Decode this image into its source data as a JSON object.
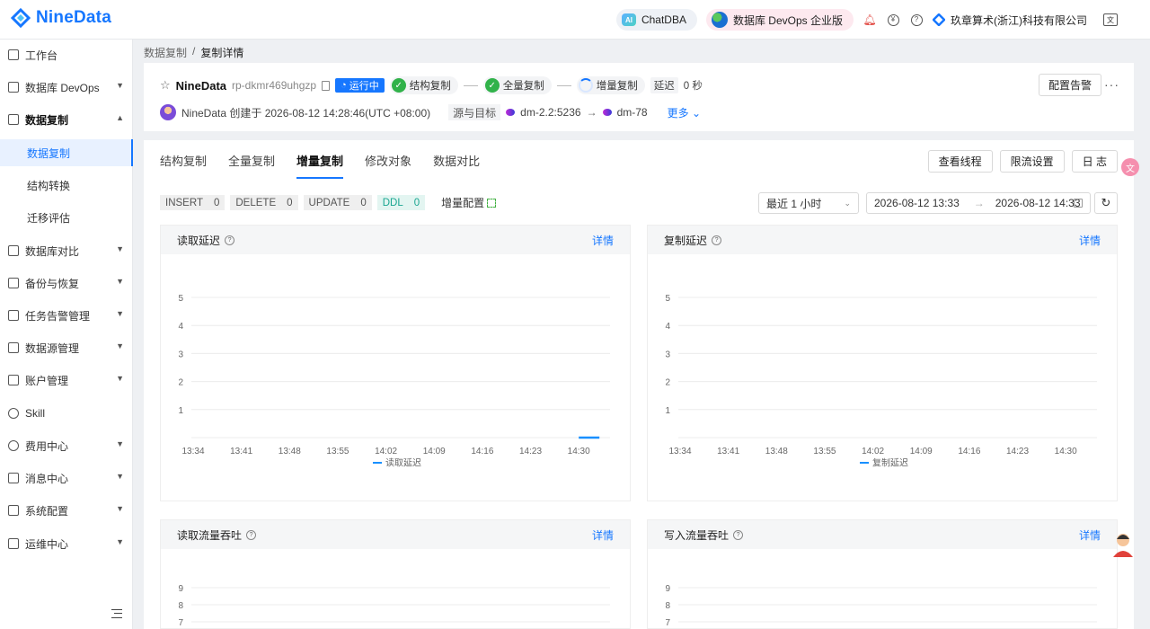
{
  "app": {
    "logo_text": "NineData",
    "chatdba_label": "ChatDBA",
    "ai_badge": "AI",
    "devops_label": "数据库 DevOps 企业版",
    "company": "玖章算术(浙江)科技有限公司",
    "lang_icon": "文",
    "accent": "#1677ff"
  },
  "sidebar": {
    "items": [
      {
        "label": "工作台",
        "icon": "home-icon"
      },
      {
        "label": "数据库 DevOps",
        "icon": "monitor-icon"
      },
      {
        "label": "数据复制",
        "icon": "replicate-icon"
      },
      {
        "label": "数据库对比",
        "icon": "compare-icon"
      },
      {
        "label": "备份与恢复",
        "icon": "cloud-icon"
      },
      {
        "label": "任务告警管理",
        "icon": "alarm-icon"
      },
      {
        "label": "数据源管理",
        "icon": "datasource-icon"
      },
      {
        "label": "账户管理",
        "icon": "account-icon"
      },
      {
        "label": "Skill",
        "icon": "skill-icon"
      },
      {
        "label": "费用中心",
        "icon": "yen-icon"
      },
      {
        "label": "消息中心",
        "icon": "mail-icon"
      },
      {
        "label": "系统配置",
        "icon": "grid-icon"
      },
      {
        "label": "运维中心",
        "icon": "wrench-icon"
      }
    ],
    "sub_items": [
      "数据复制",
      "结构转换",
      "迁移评估"
    ]
  },
  "breadcrumb": {
    "root": "数据复制",
    "sep": "/",
    "current": "复制详情"
  },
  "task": {
    "name": "NineData",
    "id": "rp-dkmr469uhgzp",
    "status": "运行中",
    "stages": [
      "结构复制",
      "全量复制",
      "增量复制"
    ],
    "delay_label": "延迟",
    "delay_value": "0 秒",
    "alarm_button": "配置告警",
    "more_dots": "···",
    "creator_text": "NineData 创建于 2026-08-12 14:28:46(UTC +08:00)",
    "src_tgt_label": "源与目标",
    "source": "dm-2.2:5236",
    "arrow": "→",
    "target": "dm-78",
    "more": "更多"
  },
  "tabs": [
    "结构复制",
    "全量复制",
    "增量复制",
    "修改对象",
    "数据对比"
  ],
  "tab_buttons": [
    "查看线程",
    "限流设置",
    "日 志"
  ],
  "counters": [
    {
      "key": "INSERT",
      "value": "0"
    },
    {
      "key": "DELETE",
      "value": "0"
    },
    {
      "key": "UPDATE",
      "value": "0"
    },
    {
      "key": "DDL",
      "value": "0"
    }
  ],
  "inc_config": "增量配置",
  "filter": {
    "range_select": "最近 1 小时",
    "start": "2026-08-12 13:33",
    "arrow": "→",
    "end": "2026-08-12 14:33",
    "refresh_icon": "↻"
  },
  "charts": [
    {
      "title": "读取延迟",
      "link": "详情",
      "legend": "读取延迟"
    },
    {
      "title": "复制延迟",
      "link": "详情",
      "legend": "复制延迟"
    },
    {
      "title": "读取流量吞吐",
      "link": "详情"
    },
    {
      "title": "写入流量吞吐",
      "link": "详情"
    }
  ],
  "chart_data": [
    {
      "type": "line",
      "title": "读取延迟",
      "categories": [
        "13:34",
        "13:41",
        "13:48",
        "13:55",
        "14:02",
        "14:09",
        "14:16",
        "14:23",
        "14:30"
      ],
      "yticks": [
        1,
        2,
        3,
        4,
        5
      ],
      "ylim": [
        0,
        5
      ],
      "series": [
        {
          "name": "读取延迟",
          "x": [
            "14:30",
            "14:33"
          ],
          "values": [
            0,
            0
          ],
          "color": "#1890ff"
        }
      ],
      "legend": "bottom",
      "grid": true
    },
    {
      "type": "line",
      "title": "复制延迟",
      "categories": [
        "13:34",
        "13:41",
        "13:48",
        "13:55",
        "14:02",
        "14:09",
        "14:16",
        "14:23",
        "14:30"
      ],
      "yticks": [
        1,
        2,
        3,
        4,
        5
      ],
      "ylim": [
        0,
        5
      ],
      "series": [
        {
          "name": "复制延迟",
          "values": [],
          "color": "#1890ff"
        }
      ],
      "legend": "bottom",
      "grid": true
    },
    {
      "type": "line",
      "title": "读取流量吞吐",
      "yticks": [
        7,
        8,
        9
      ],
      "grid": true
    },
    {
      "type": "line",
      "title": "写入流量吞吐",
      "yticks": [
        7,
        8,
        9
      ],
      "grid": true
    }
  ]
}
